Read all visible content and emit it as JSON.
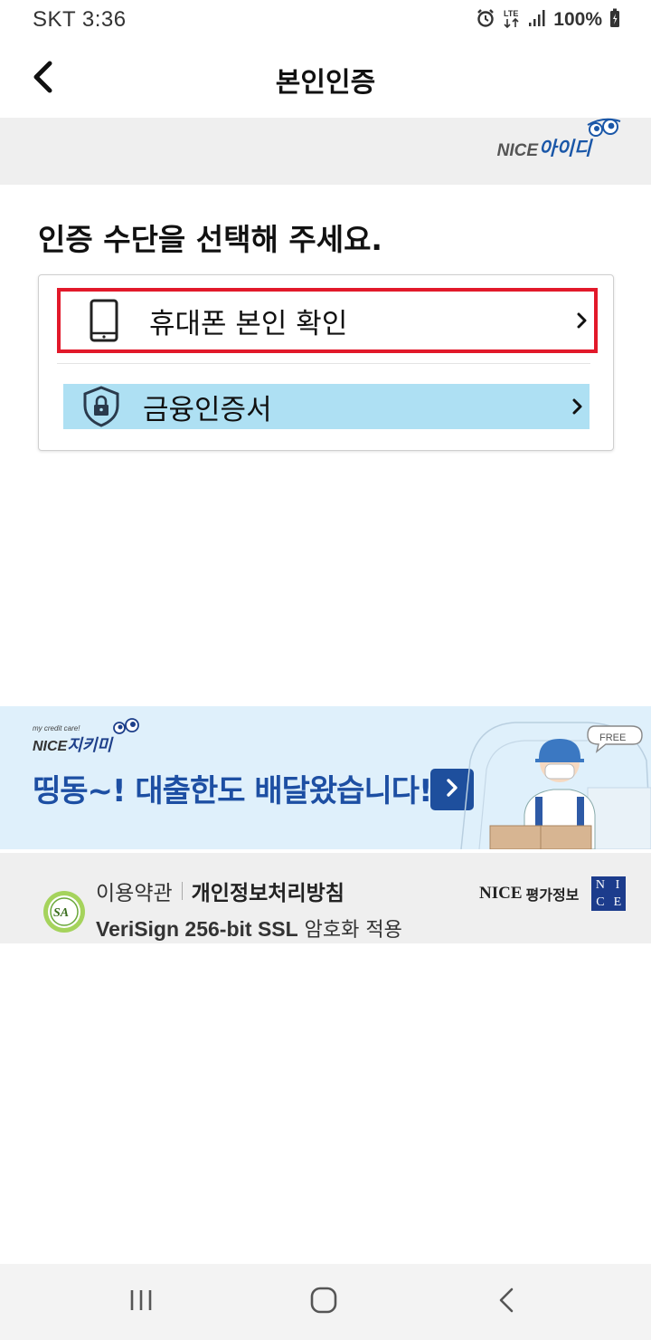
{
  "status_bar": {
    "carrier_time": "SKT 3:36",
    "network": "LTE",
    "battery": "100%"
  },
  "app_bar": {
    "title": "본인인증",
    "back_icon": "chevron-left-icon"
  },
  "brand": {
    "nice": "NICE",
    "name": "아이디"
  },
  "main": {
    "heading": "인증 수단을 선택해 주세요.",
    "methods": [
      {
        "label": "휴대폰 본인 확인",
        "icon": "smartphone-icon",
        "highlight_color": "#e2192a"
      },
      {
        "label": "금융인증서",
        "icon": "shield-lock-icon",
        "highlight_color": "#aee0f3"
      }
    ]
  },
  "banner": {
    "logo_small": "my credit care!",
    "logo_nice": "NICE",
    "logo_name": "지키미",
    "headline": "띵동~! 대출한도 배달왔습니다!",
    "bubble": "FREE"
  },
  "footer": {
    "terms": "이용약관",
    "privacy": "개인정보처리방침",
    "ssl_strong": "VeriSign 256-bit SSL",
    "ssl_rest": " 암호화 적용",
    "sa_badge": "SA",
    "nice_rating": "NICE",
    "nice_rating_kor": "평가정보",
    "nice_square_letters": [
      "N",
      "I",
      "C",
      "E"
    ]
  },
  "colors": {
    "accent_blue": "#1d4fa3",
    "highlight_red": "#e2192a",
    "highlight_cyan": "#aee0f3",
    "banner_bg": "#dff0fb"
  },
  "nav_bar": {
    "recent_icon": "recent-apps-icon",
    "home_icon": "home-icon",
    "back_icon": "back-icon"
  }
}
